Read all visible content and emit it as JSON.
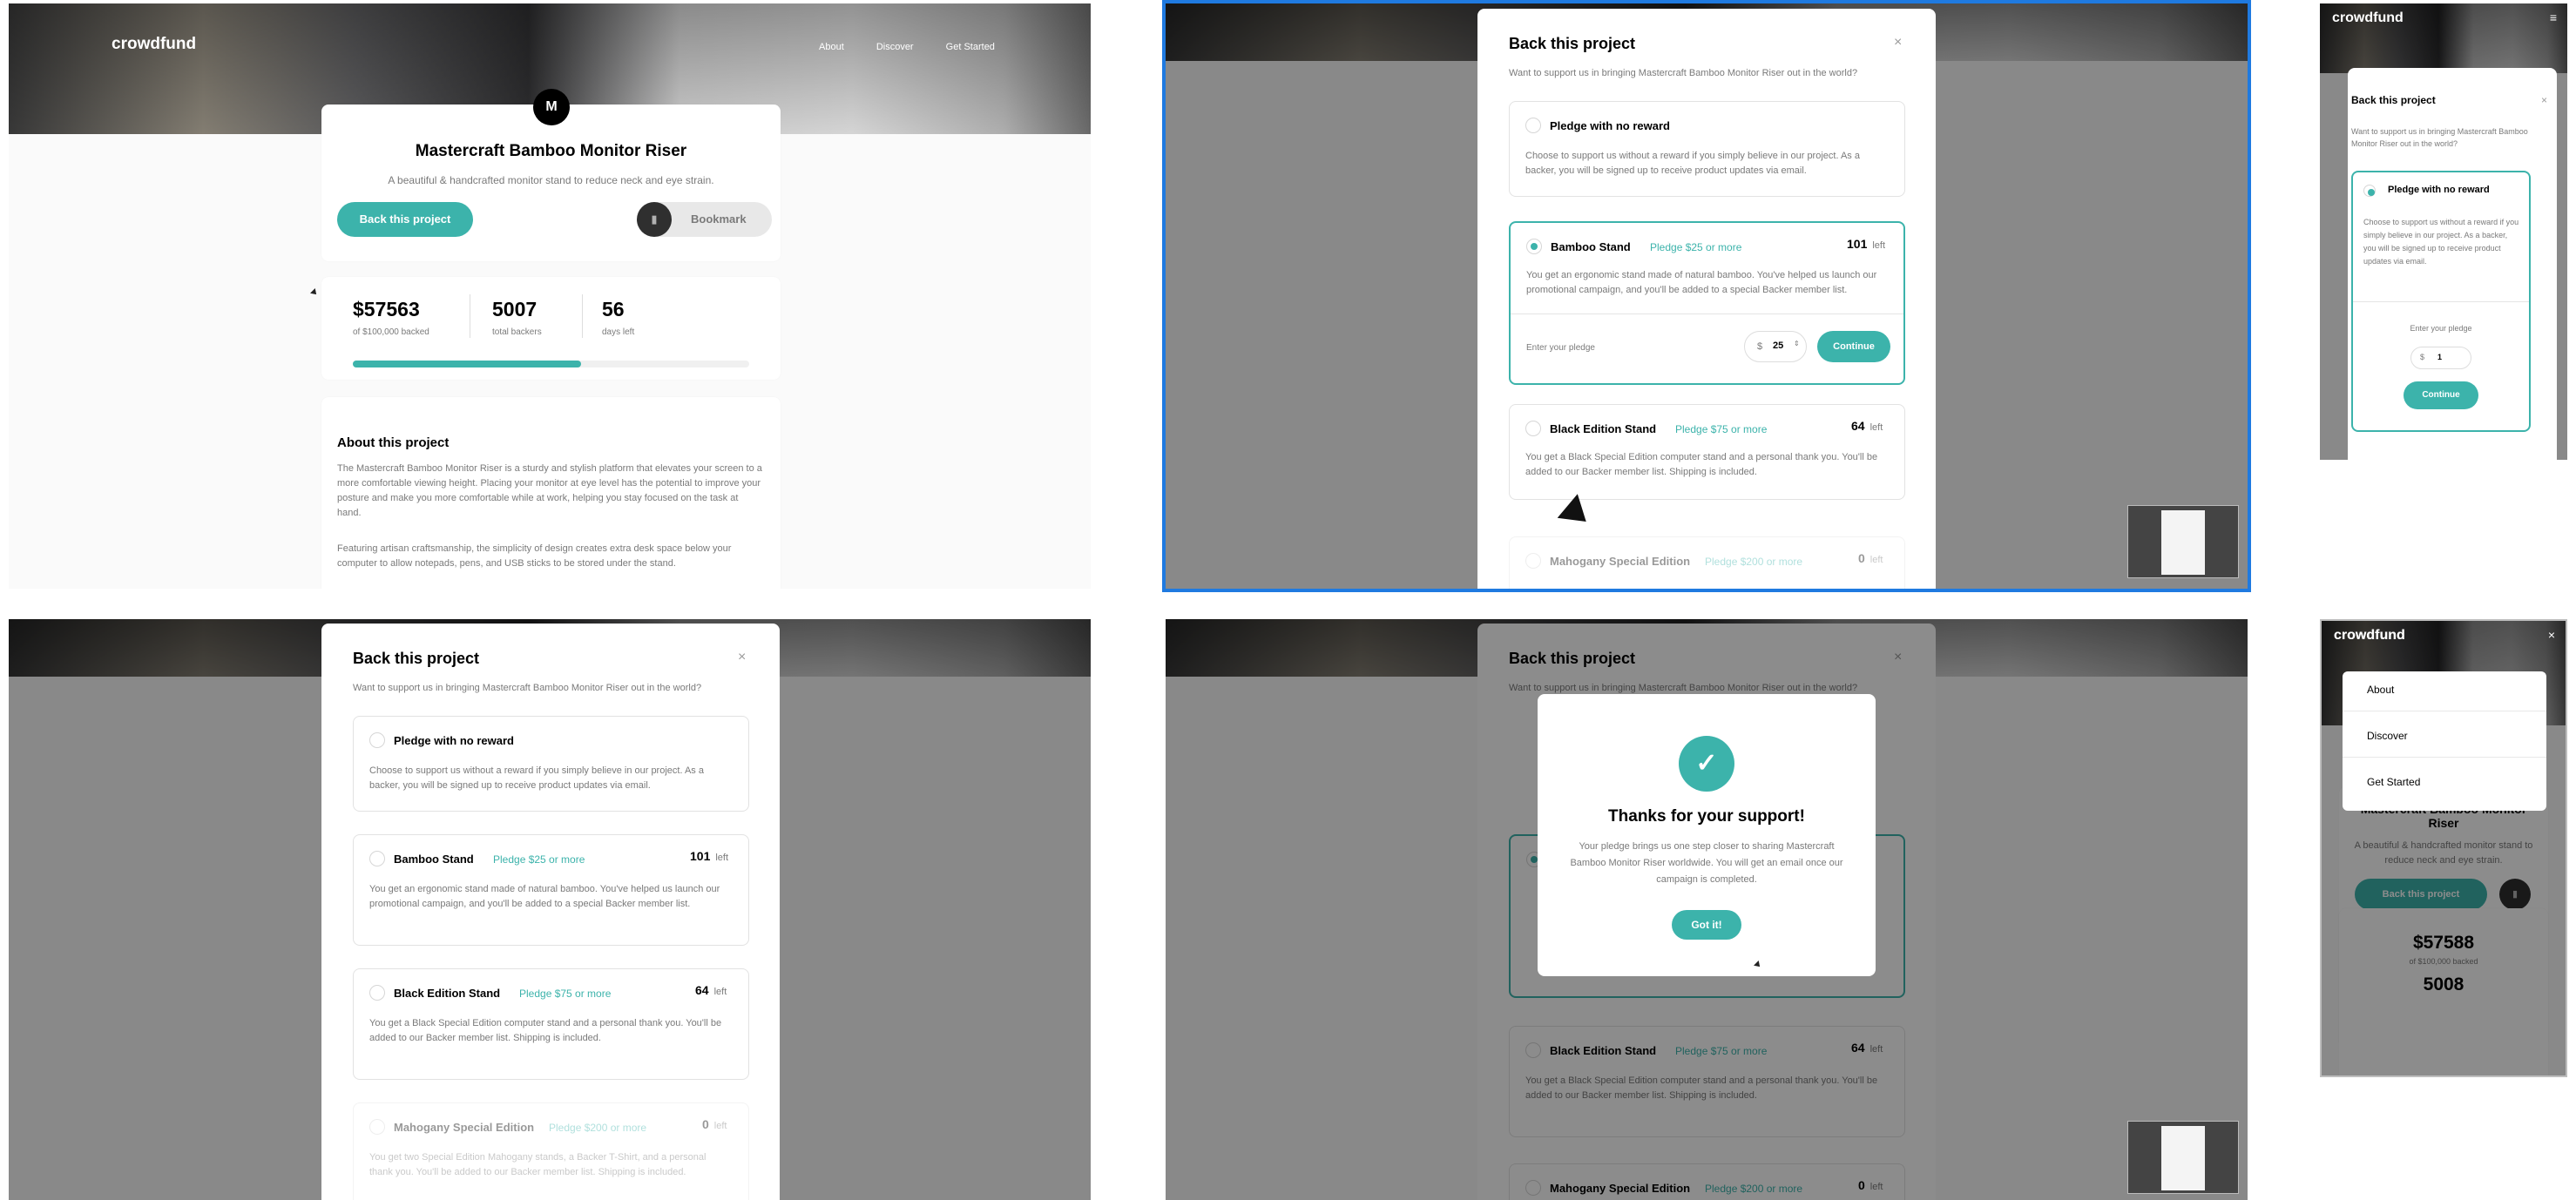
{
  "app": {
    "logo": "crowdfund",
    "nav": [
      "About",
      "Discover",
      "Get Started"
    ]
  },
  "project": {
    "title": "Mastercraft Bamboo Monitor Riser",
    "tagline": "A beautiful & handcrafted monitor stand to reduce neck and eye strain.",
    "back_label": "Back this project",
    "bookmark_label": "Bookmark",
    "amount": "$57563",
    "amount_caption": "of $100,000 backed",
    "backers": "5007",
    "backers_caption": "total backers",
    "days": "56",
    "days_caption": "days left",
    "progress": 0.576,
    "about_title": "About this project",
    "about_p1": "The Mastercraft Bamboo Monitor Riser is a sturdy and stylish platform that elevates your screen to a more comfortable viewing height. Placing your monitor at eye level has the potential to improve your posture and make you more comfortable while at work, helping you stay focused on the task at hand.",
    "about_p2": "Featuring artisan craftsmanship, the simplicity of design creates extra desk space below your computer to allow notepads, pens, and USB sticks to be stored under the stand."
  },
  "modal": {
    "title": "Back this project",
    "close": "×",
    "subtitle": "Want to support us in bringing Mastercraft Bamboo Monitor Riser out in the world?",
    "enter_pledge": "Enter your pledge",
    "currency": "$",
    "pledge_value": "25",
    "mobile_pledge_value": "1",
    "continue_label": "Continue",
    "left_word": "left",
    "options": [
      {
        "name": "Pledge with no reward",
        "pledge": "",
        "left": "",
        "desc": "Choose to support us without a reward if you simply believe in our project. As a backer, you will be signed up to receive product updates via email."
      },
      {
        "name": "Bamboo Stand",
        "pledge": "Pledge $25 or more",
        "left": "101",
        "desc": "You get an ergonomic stand made of natural bamboo. You've helped us launch our promotional campaign, and you'll be added to a special Backer member list."
      },
      {
        "name": "Black Edition Stand",
        "pledge": "Pledge $75 or more",
        "left": "64",
        "desc": "You get a Black Special Edition computer stand and a personal thank you. You'll be added to our Backer member list. Shipping is included."
      },
      {
        "name": "Mahogany Special Edition",
        "pledge": "Pledge $200 or more",
        "left": "0",
        "desc": "You get two Special Edition Mahogany stands, a Backer T-Shirt, and a personal thank you. You'll be added to our Backer member list. Shipping is included."
      }
    ]
  },
  "success": {
    "title": "Thanks for your support!",
    "body": "Your pledge brings us one step closer to sharing Mastercraft Bamboo Monitor Riser worldwide. You will get an email once our campaign is completed.",
    "button": "Got it!"
  },
  "mobile": {
    "amount": "$57588",
    "amount_caption": "of $100,000 backed",
    "backers": "5008",
    "close": "×"
  },
  "colors": {
    "accent": "#3cb3ab",
    "dark": "#2f2f2f",
    "selection_outline": "#1f7ae0"
  }
}
